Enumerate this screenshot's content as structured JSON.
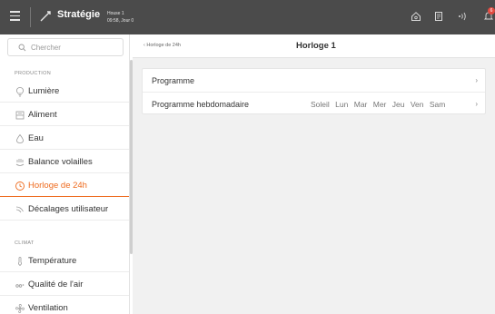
{
  "topbar": {
    "title": "Stratégie",
    "house": "House 1",
    "time_day": "09:58, Jour 0",
    "notification_count": "6"
  },
  "sidebar": {
    "search_placeholder": "Chercher",
    "sections": [
      {
        "title": "PRODUCTION",
        "items": [
          {
            "label": "Lumière",
            "icon": "lightbulb-icon"
          },
          {
            "label": "Aliment",
            "icon": "feed-icon"
          },
          {
            "label": "Eau",
            "icon": "water-drop-icon"
          },
          {
            "label": "Balance volailles",
            "icon": "poultry-scale-icon"
          },
          {
            "label": "Horloge de 24h",
            "icon": "clock-icon",
            "active": true
          },
          {
            "label": "Décalages utilisateur",
            "icon": "user-offset-icon"
          }
        ]
      },
      {
        "title": "CLIMAT",
        "items": [
          {
            "label": "Température",
            "icon": "thermometer-icon"
          },
          {
            "label": "Qualité de l'air",
            "icon": "air-quality-icon"
          },
          {
            "label": "Ventilation",
            "icon": "fan-icon"
          }
        ]
      }
    ]
  },
  "main": {
    "breadcrumb": "Horloge de 24h",
    "title": "Horloge 1",
    "rows": [
      {
        "label": "Programme"
      },
      {
        "label": "Programme hebdomadaire",
        "days": [
          "Soleil",
          "Lun",
          "Mar",
          "Mer",
          "Jeu",
          "Ven",
          "Sam"
        ]
      }
    ]
  },
  "colors": {
    "topbar": "#4b4b4b",
    "accent": "#ee6a1d",
    "badge": "#e34b41",
    "content_bg": "#f1f1f1"
  }
}
